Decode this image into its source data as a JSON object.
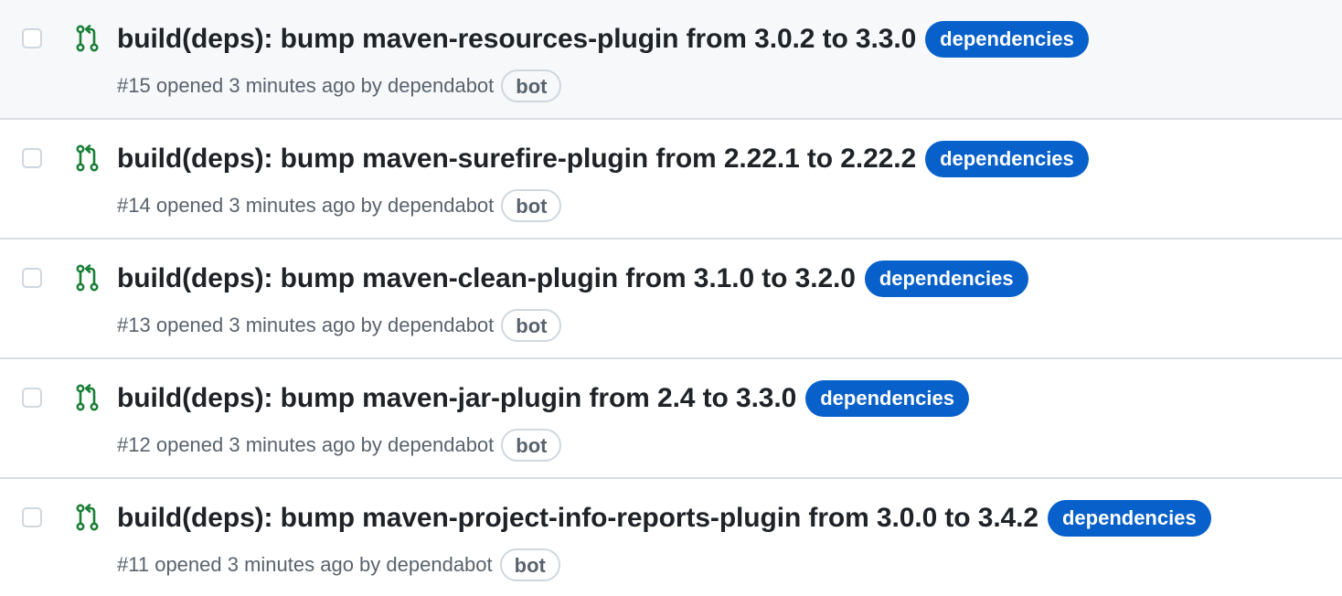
{
  "colors": {
    "accent_label": "#0860ca",
    "open_pr_icon": "#1a7f37",
    "title_text": "#1f2328",
    "meta_text": "#59636e",
    "hover_row_bg": "#f6f8fa",
    "divider": "#d8dee4"
  },
  "pull_requests": [
    {
      "icon": "git-pull-request-open-icon",
      "title": "build(deps): bump maven-resources-plugin from 3.0.2 to 3.3.0",
      "label": "dependencies",
      "number": "#15",
      "opened_text": "opened 3 minutes ago by",
      "author": "dependabot",
      "author_badge": "bot",
      "hovered": true
    },
    {
      "icon": "git-pull-request-open-icon",
      "title": "build(deps): bump maven-surefire-plugin from 2.22.1 to 2.22.2",
      "label": "dependencies",
      "number": "#14",
      "opened_text": "opened 3 minutes ago by",
      "author": "dependabot",
      "author_badge": "bot",
      "hovered": false
    },
    {
      "icon": "git-pull-request-open-icon",
      "title": "build(deps): bump maven-clean-plugin from 3.1.0 to 3.2.0",
      "label": "dependencies",
      "number": "#13",
      "opened_text": "opened 3 minutes ago by",
      "author": "dependabot",
      "author_badge": "bot",
      "hovered": false
    },
    {
      "icon": "git-pull-request-open-icon",
      "title": "build(deps): bump maven-jar-plugin from 2.4 to 3.3.0",
      "label": "dependencies",
      "number": "#12",
      "opened_text": "opened 3 minutes ago by",
      "author": "dependabot",
      "author_badge": "bot",
      "hovered": false
    },
    {
      "icon": "git-pull-request-open-icon",
      "title": "build(deps): bump maven-project-info-reports-plugin from 3.0.0 to 3.4.2",
      "label": "dependencies",
      "number": "#11",
      "opened_text": "opened 3 minutes ago by",
      "author": "dependabot",
      "author_badge": "bot",
      "hovered": false
    }
  ]
}
